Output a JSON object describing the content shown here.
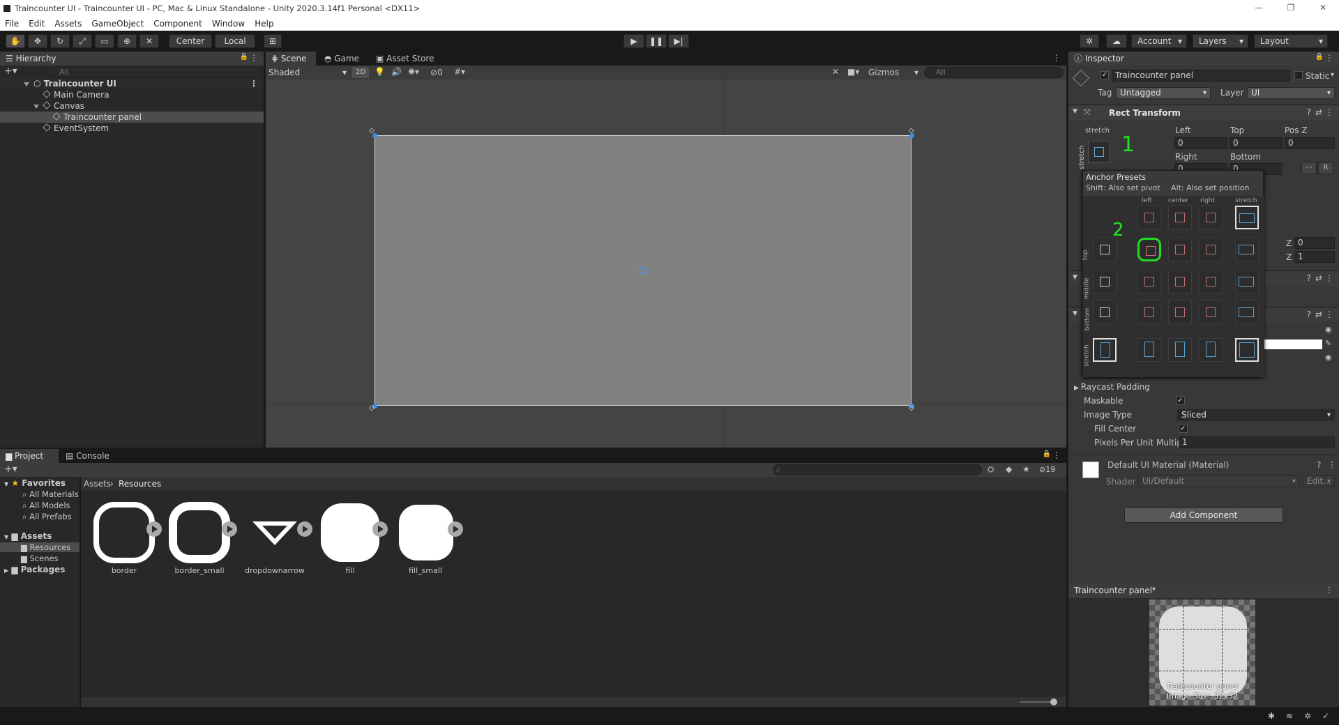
{
  "window": {
    "title": "Traincounter UI - Traincounter UI - PC, Mac & Linux Standalone - Unity 2020.3.14f1 Personal <DX11>"
  },
  "menu": [
    "File",
    "Edit",
    "Assets",
    "GameObject",
    "Component",
    "Window",
    "Help"
  ],
  "toolbar": {
    "center": "Center",
    "local": "Local",
    "account": "Account",
    "layers": "Layers",
    "layout": "Layout"
  },
  "hierarchy": {
    "tab": "Hierarchy",
    "search_placeholder": "All",
    "scene": "Traincounter UI",
    "items": [
      {
        "label": "Main Camera"
      },
      {
        "label": "Canvas"
      },
      {
        "label": "Traincounter panel"
      },
      {
        "label": "EventSystem"
      }
    ]
  },
  "scene": {
    "tabs": [
      "Scene",
      "Game",
      "Asset Store"
    ],
    "shading": "Shaded",
    "mode2d": "2D",
    "hidden_count": "0",
    "gizmos": "Gizmos",
    "search_placeholder": "All"
  },
  "inspector": {
    "tab": "Inspector",
    "object_name": "Traincounter panel",
    "static": "Static",
    "tag_label": "Tag",
    "tag": "Untagged",
    "layer_label": "Layer",
    "layer": "UI",
    "rect": {
      "title": "Rect Transform",
      "stretch": "stretch",
      "stretch_side": "stretch",
      "left_label": "Left",
      "top_label": "Top",
      "posz_label": "Pos Z",
      "left": "0",
      "top": "0",
      "posz": "0",
      "right_label": "Right",
      "bottom_label": "Bottom",
      "right": "0",
      "bottom": "0",
      "z1_label": "Z",
      "z1": "0",
      "z2_label": "Z",
      "z2": "1"
    },
    "image": {
      "raycast_padding": "Raycast Padding",
      "maskable": "Maskable",
      "image_type_label": "Image Type",
      "image_type": "Sliced",
      "fill_center": "Fill Center",
      "ppu_label": "Pixels Per Unit Multip",
      "ppu": "1"
    },
    "material": {
      "name": "Default UI Material (Material)",
      "shader_label": "Shader",
      "shader": "UI/Default",
      "edit": "Edit..."
    },
    "add_component": "Add Component",
    "preview": {
      "title": "Traincounter panel",
      "name": "Traincounter panel",
      "size": "Image Size: 32x32"
    }
  },
  "anchor_presets": {
    "title": "Anchor Presets",
    "hint_shift": "Shift: Also set pivot",
    "hint_alt": "Alt: Also set position",
    "cols": [
      "left",
      "center",
      "right",
      "stretch"
    ],
    "rows": [
      "top",
      "middle",
      "bottom",
      "stretch"
    ],
    "annotation1": "1",
    "annotation2": "2"
  },
  "project": {
    "tabs": [
      "Project",
      "Console"
    ],
    "hidden_count": "19",
    "breadcrumb": [
      "Assets",
      "Resources"
    ],
    "favorites": "Favorites",
    "fav_items": [
      "All Materials",
      "All Models",
      "All Prefabs"
    ],
    "assets_root": "Assets",
    "folders": [
      "Resources",
      "Scenes"
    ],
    "packages": "Packages",
    "assets": [
      {
        "name": "border"
      },
      {
        "name": "border_small"
      },
      {
        "name": "dropdownarrow"
      },
      {
        "name": "fill"
      },
      {
        "name": "fill_small"
      }
    ]
  }
}
